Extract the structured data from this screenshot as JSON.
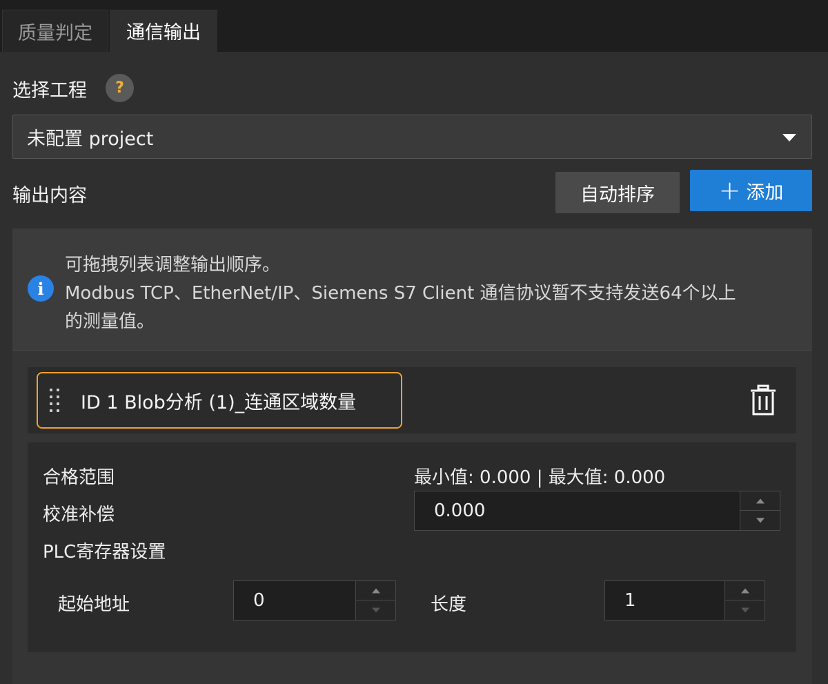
{
  "tabs": [
    {
      "label": "质量判定",
      "active": false
    },
    {
      "label": "通信输出",
      "active": true
    }
  ],
  "project": {
    "label": "选择工程",
    "help": "?",
    "selected": "未配置 project"
  },
  "output": {
    "label": "输出内容",
    "sort_button": "自动排序",
    "add_button": "添加"
  },
  "info": {
    "lines": [
      "可拖拽列表调整输出顺序。",
      "Modbus TCP、EtherNet/IP、Siemens S7 Client 通信协议暂不支持发送64个以上",
      "的测量值。"
    ]
  },
  "item": {
    "title": "ID 1  Blob分析 (1)_连通区域数量",
    "qualified_range_label": "合格范围",
    "range_text": "最小值: 0.000 | 最大值: 0.000",
    "calibration_label": "校准补偿",
    "calibration_value": "0.000",
    "plc_label": "PLC寄存器设置",
    "start_address_label": "起始地址",
    "start_address_value": "0",
    "length_label": "长度",
    "length_value": "1"
  },
  "colors": {
    "accent": "#1f7ed6",
    "highlight_border": "#f0a030",
    "help_badge": "#f2b233",
    "info_icon": "#2a82e4"
  }
}
